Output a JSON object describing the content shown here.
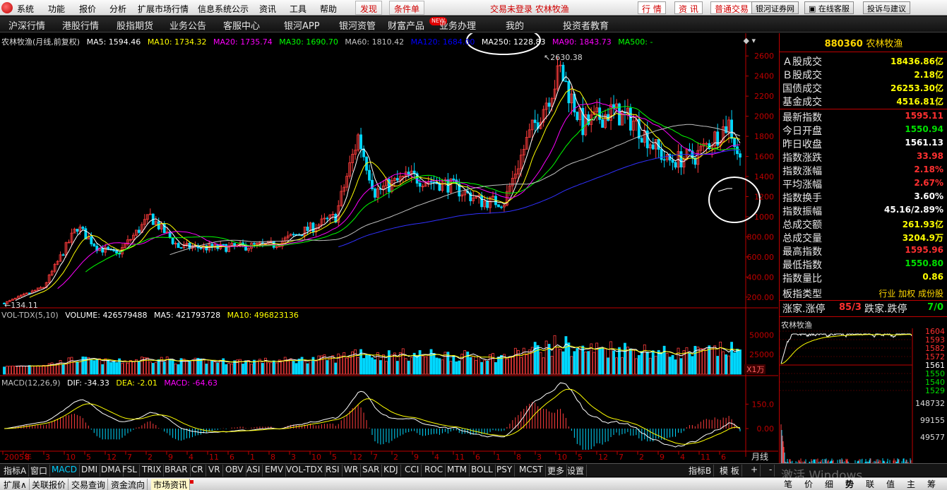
{
  "menu": {
    "items": [
      "系统",
      "功能",
      "报价",
      "分析",
      "扩展市场行情",
      "信息系统公示",
      "资讯",
      "工具",
      "帮助"
    ],
    "tab_discover": "发现",
    "tab_condition": "条件单",
    "status": "交易未登录  农林牧渔",
    "btn_quote": "行 情",
    "btn_news": "资 讯",
    "btn_trade": "普通交易",
    "btn_bank": "银河证券网",
    "btn_service": "在线客服",
    "btn_complain": "投诉与建议"
  },
  "nav": {
    "items": [
      "沪深行情",
      "港股行情",
      "股指期货",
      "业务公告",
      "客服中心",
      "银河APP",
      "银河资管",
      "财富产品",
      "业务办理",
      "我的",
      "投资者教育"
    ],
    "new_badge": "NEW"
  },
  "main_chart": {
    "title": "农林牧渔(月线,前复权)",
    "ma": [
      {
        "label": "MA5: 1594.46",
        "color": "#ffffff"
      },
      {
        "label": "MA10: 1734.32",
        "color": "#ffff00"
      },
      {
        "label": "MA20: 1735.74",
        "color": "#ff00ff"
      },
      {
        "label": "MA30: 1690.70",
        "color": "#00ff00"
      },
      {
        "label": "MA60: 1810.42",
        "color": "#c0c0c0"
      },
      {
        "label": "MA120: 1684.00",
        "color": "#0000ff"
      },
      {
        "label": "MA250: 1228.83",
        "color": "#ffffff"
      },
      {
        "label": "MA90: 1843.73",
        "color": "#ff00ff"
      },
      {
        "label": "MA500: -",
        "color": "#00ff00"
      }
    ],
    "high_label": "2630.38",
    "low_label": "134.11",
    "y_ticks": [
      "2600",
      "2400",
      "2200",
      "2000",
      "1800",
      "1600",
      "1400",
      "1200",
      "1000",
      "800.00",
      "600.00",
      "400.00",
      "200.00"
    ]
  },
  "volume": {
    "labels": [
      {
        "label": "VOL-TDX(5,10)",
        "color": "#c0c0c0"
      },
      {
        "label": "VOLUME: 426579488",
        "color": "#ffffff"
      },
      {
        "label": "MA5: 421793728",
        "color": "#ffffff"
      },
      {
        "label": "MA10: 496823136",
        "color": "#ffff00"
      }
    ],
    "y_ticks": [
      "50000",
      "25000"
    ],
    "unit": "X1万"
  },
  "macd": {
    "labels": [
      {
        "label": "MACD(12,26,9)",
        "color": "#c0c0c0"
      },
      {
        "label": "DIF: -34.33",
        "color": "#ffffff"
      },
      {
        "label": "DEA: -2.01",
        "color": "#ffff00"
      },
      {
        "label": "MACD: -64.63",
        "color": "#ff00ff"
      }
    ],
    "y_ticks": [
      "150.0",
      "0.00"
    ]
  },
  "x_axis": {
    "labels": [
      "2005年",
      "8",
      "3",
      "10",
      "5",
      "12",
      "7",
      "2",
      "9",
      "4",
      "11",
      "6",
      "1",
      "8",
      "3",
      "10",
      "5",
      "12",
      "7",
      "2",
      "9",
      "4",
      "11",
      "6",
      "1",
      "8",
      "3",
      "10",
      "5",
      "12",
      "7",
      "2",
      "9",
      "4",
      "11",
      "6"
    ],
    "period": "月线"
  },
  "panel": {
    "code": "880360",
    "name": "农林牧渔",
    "rows": [
      {
        "label": "Ａ股成交",
        "value": "18436.86亿",
        "color": "#ffff00"
      },
      {
        "label": "Ｂ股成交",
        "value": "2.18亿",
        "color": "#ffff00"
      },
      {
        "label": "国债成交",
        "value": "26253.30亿",
        "color": "#ffff00"
      },
      {
        "label": "基金成交",
        "value": "4516.81亿",
        "color": "#ffff00"
      },
      {
        "label": "最新指数",
        "value": "1595.11",
        "color": "#ff3030"
      },
      {
        "label": "今日开盘",
        "value": "1550.94",
        "color": "#00e000"
      },
      {
        "label": "昨日收盘",
        "value": "1561.13",
        "color": "#ffffff"
      },
      {
        "label": "指数涨跌",
        "value": "33.98",
        "color": "#ff3030"
      },
      {
        "label": "指数涨幅",
        "value": "2.18%",
        "color": "#ff3030"
      },
      {
        "label": "平均涨幅",
        "value": "2.67%",
        "color": "#ff3030"
      },
      {
        "label": "指数换手",
        "value": "3.60%",
        "color": "#ffffff"
      },
      {
        "label": "指数振幅",
        "value": "45.16/2.89%",
        "color": "#ffffff"
      },
      {
        "label": "总成交额",
        "value": "261.93亿",
        "color": "#ffff00"
      },
      {
        "label": "总成交量",
        "value": "3204.9万",
        "color": "#ffff00"
      },
      {
        "label": "最高指数",
        "value": "1595.96",
        "color": "#ff3030"
      },
      {
        "label": "最低指数",
        "value": "1550.80",
        "color": "#00e000"
      },
      {
        "label": "指数量比",
        "value": "0.86",
        "color": "#ffff00"
      }
    ],
    "type_label": "板指类型",
    "type_value": "行业 加权 成份股",
    "updown_label": "涨家.涨停",
    "updown_value": "85/3",
    "down_label": "跌家.跌停",
    "down_value": "7/0",
    "mini_title": "农林牧渔",
    "mini_y": [
      "1604",
      "1593",
      "1582",
      "1572",
      "1561",
      "1550",
      "1540",
      "1529"
    ],
    "mini_vol": [
      "148732",
      "99155",
      "49577"
    ],
    "tabs": [
      "笔",
      "价",
      "细",
      "势",
      "联",
      "值",
      "主",
      "筹"
    ]
  },
  "indicator_tabs": [
    "指标A",
    "窗口",
    "MACD",
    "DMI",
    "DMA",
    "FSL",
    "TRIX",
    "BRAR",
    "CR",
    "VR",
    "OBV",
    "ASI",
    "EMV",
    "VOL-TDX",
    "RSI",
    "WR",
    "SAR",
    "KDJ",
    "CCI",
    "ROC",
    "MTM",
    "BOLL",
    "PSY",
    "MCST",
    "更多",
    "设置"
  ],
  "indicator_right": [
    "指标B",
    "模 板",
    "+",
    "-"
  ],
  "bottom_tabs": [
    "扩展∧",
    "关联报价",
    "交易查询",
    "资金流向",
    "市场资讯"
  ],
  "watermark": "激活 Windows"
}
